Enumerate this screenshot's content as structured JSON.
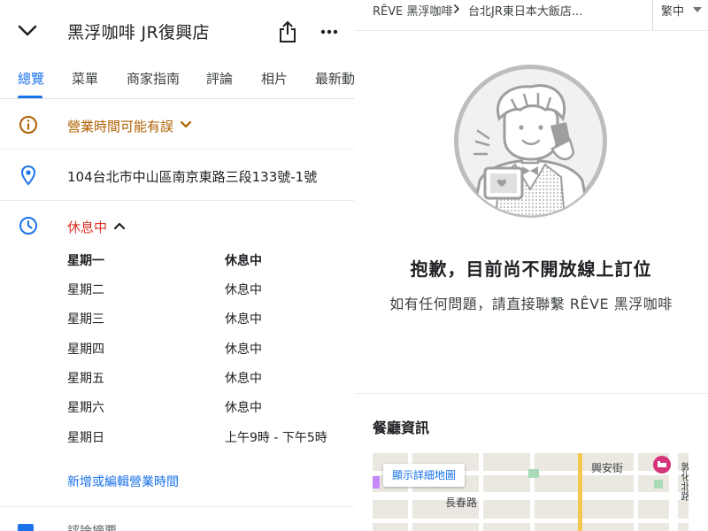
{
  "place": {
    "title": "黑浮咖啡 JR復興店",
    "tabs": [
      "總覽",
      "菜單",
      "商家指南",
      "評論",
      "相片",
      "最新動"
    ],
    "hours_warning": "營業時間可能有誤",
    "address": "104台北市中山區南京東路三段133號-1號",
    "status": "休息中",
    "hours": [
      {
        "day": "星期一",
        "hours": "休息中",
        "bold": true
      },
      {
        "day": "星期二",
        "hours": "休息中",
        "bold": false
      },
      {
        "day": "星期三",
        "hours": "休息中",
        "bold": false
      },
      {
        "day": "星期四",
        "hours": "休息中",
        "bold": false
      },
      {
        "day": "星期五",
        "hours": "休息中",
        "bold": false
      },
      {
        "day": "星期六",
        "hours": "休息中",
        "bold": false
      },
      {
        "day": "星期日",
        "hours": "上午9時 - 下午5時",
        "bold": false
      }
    ],
    "edit_hours_link": "新增或編輯營業時間",
    "next_item_peek": "評論摘要"
  },
  "booking": {
    "breadcrumb_1": "RÊVE 黑浮咖啡",
    "breadcrumb_2": "台北JR東日本大飯店...",
    "language": "繁中",
    "sorry_title": "抱歉，目前尚不開放線上訂位",
    "sorry_message": "如有任何問題，請直接聯繫 RÊVE 黑浮咖啡",
    "info_title": "餐廳資訊",
    "map": {
      "button": "顯示詳細地圖",
      "street_1": "長春路",
      "street_2": "興安街",
      "street_3": "敦化北路"
    }
  },
  "colors": {
    "link_blue": "#1a73e8",
    "warning_orange": "#b06000",
    "closed_red": "#d93025",
    "text": "#202124",
    "map_pin_pink": "#d5337a"
  },
  "icons": [
    "chevron-down-icon",
    "share-icon",
    "more-icon",
    "info-icon",
    "location-pin-icon",
    "clock-icon",
    "chevron-right-icon",
    "caret-down-icon",
    "map-pin-icon"
  ]
}
